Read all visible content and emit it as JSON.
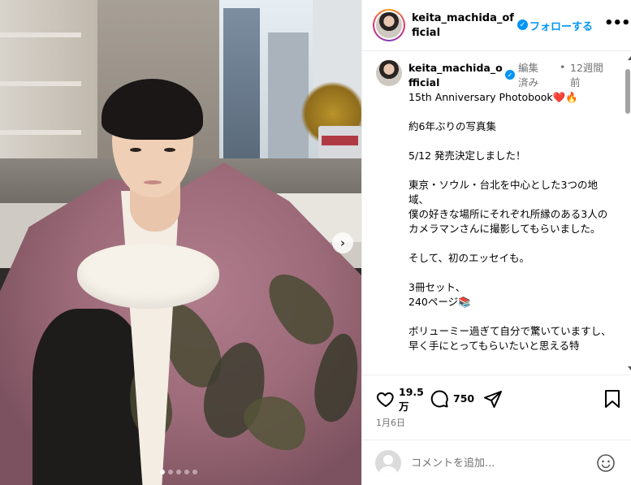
{
  "header": {
    "username": "keita_machida_official",
    "follow_label": "フォローする",
    "more_icon": "more-dots-icon"
  },
  "post": {
    "username": "keita_machida_official",
    "edited_label": "編集済み",
    "separator": "•",
    "time_ago": "12週間前",
    "caption": "15th Anniversary Photobook❤️🔥\n\n約6年ぶりの写真集\n\n5/12 発売決定しました！\n\n東京・ソウル・台北を中心とした3つの地域、\n僕の好きな場所にそれぞれ所縁のある3人のカメラマンさんに撮影してもらいました。\n\nそして、初のエッセイも。\n\n3冊セット、\n240ページ📚\n\nボリューミー過ぎて自分で驚いていますし、\n早く手にとってもらいたいと思える特"
  },
  "carousel": {
    "next_icon": "chevron-right-icon",
    "next_glyph": "›",
    "slide_count": 5,
    "active_index": 0
  },
  "actions": {
    "likes": "19.5万",
    "comments": "750",
    "date": "1月6日"
  },
  "comment_box": {
    "placeholder": "コメントを追加..."
  },
  "colors": {
    "accent_blue": "#0095f6",
    "muted_text": "#737373",
    "border": "#efefef"
  }
}
